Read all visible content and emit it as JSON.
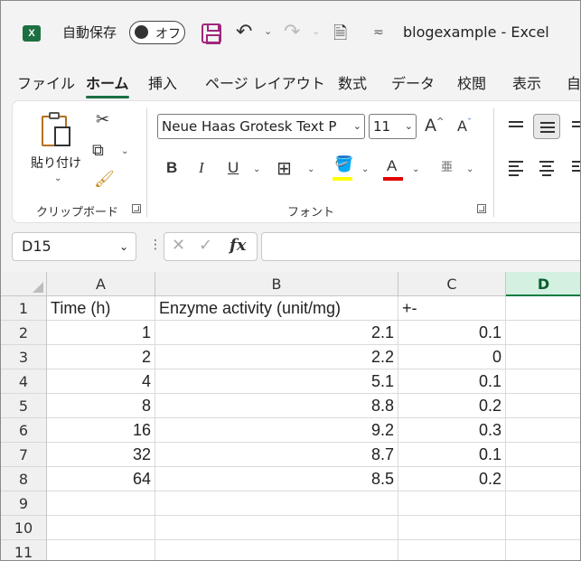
{
  "titlebar": {
    "app_logo": "X",
    "autosave_label": "自動保存",
    "autosave_state": "オフ",
    "doc_title": "blogexample  -  Excel",
    "icons": [
      "excel-logo",
      "save-icon",
      "undo-icon",
      "redo-icon",
      "page-setup-icon",
      "customize-qat-icon"
    ]
  },
  "tabs": [
    "ファイル",
    "ホーム",
    "挿入",
    "ページ レイアウト",
    "数式",
    "データ",
    "校閲",
    "表示",
    "自"
  ],
  "active_tab": "ホーム",
  "ribbon": {
    "clipboard_label": "クリップボード",
    "paste_label": "貼り付け",
    "font_label": "フォント",
    "font_name": "Neue Haas Grotesk Text P",
    "font_size": "11",
    "bold": "B",
    "italic": "I",
    "underline": "U",
    "grow_font": "A",
    "shrink_font": "A",
    "font_color_glyph": "A",
    "phonetic_glyph": "亜",
    "colors": {
      "highlight": "#ffff00",
      "font_color": "#e00000",
      "accent": "#107c41"
    }
  },
  "formula_bar": {
    "name_box": "D15",
    "fx": "fx",
    "formula": ""
  },
  "columns": [
    "A",
    "B",
    "C",
    "D"
  ],
  "selected_column": "D",
  "rows": [
    {
      "n": "1",
      "a": "Time (h)",
      "b": "Enzyme activity (unit/mg)",
      "c": "+-",
      "d": ""
    },
    {
      "n": "2",
      "a": "1",
      "b": "2.1",
      "c": "0.1",
      "d": ""
    },
    {
      "n": "3",
      "a": "2",
      "b": "2.2",
      "c": "0",
      "d": ""
    },
    {
      "n": "4",
      "a": "4",
      "b": "5.1",
      "c": "0.1",
      "d": ""
    },
    {
      "n": "5",
      "a": "8",
      "b": "8.8",
      "c": "0.2",
      "d": ""
    },
    {
      "n": "6",
      "a": "16",
      "b": "9.2",
      "c": "0.3",
      "d": ""
    },
    {
      "n": "7",
      "a": "32",
      "b": "8.7",
      "c": "0.1",
      "d": ""
    },
    {
      "n": "8",
      "a": "64",
      "b": "8.5",
      "c": "0.2",
      "d": ""
    },
    {
      "n": "9",
      "a": "",
      "b": "",
      "c": "",
      "d": ""
    },
    {
      "n": "10",
      "a": "",
      "b": "",
      "c": "",
      "d": ""
    },
    {
      "n": "11",
      "a": "",
      "b": "",
      "c": "",
      "d": ""
    }
  ]
}
